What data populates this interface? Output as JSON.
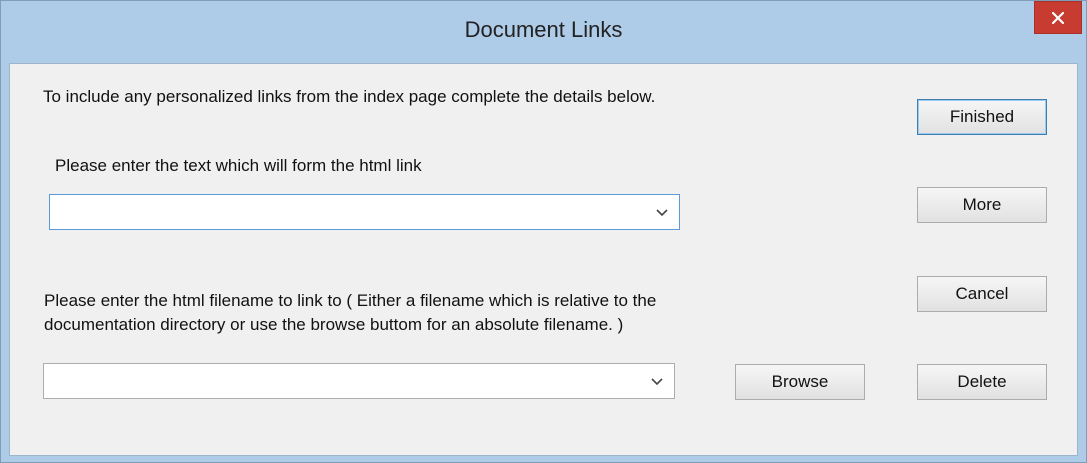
{
  "window": {
    "title": "Document Links",
    "close_glyph": "✕"
  },
  "intro_text": "To include any personalized links from the index page complete the details below.",
  "link_text": {
    "label": "Please enter the text which will form the html link",
    "value": ""
  },
  "filename": {
    "label_line1": "Please enter the html filename to link to ( Either a filename which is relative to the",
    "label_line2": " documentation directory or use the browse buttom for an absolute filename. )",
    "value": ""
  },
  "buttons": {
    "finished": "Finished",
    "more": "More",
    "cancel": "Cancel",
    "browse": "Browse",
    "delete": "Delete"
  },
  "icons": {
    "close": "close-icon",
    "dropdown": "chevron-down-icon"
  },
  "colors": {
    "titlebar": "#aecbe8",
    "close_button": "#c73b30",
    "client_bg": "#f0f0f0",
    "focus_border": "#5b9bd5"
  }
}
